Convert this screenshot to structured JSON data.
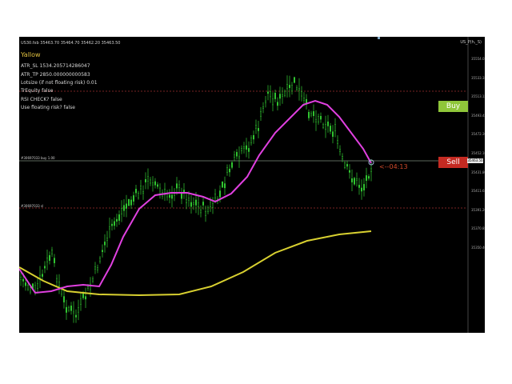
{
  "chart": {
    "symbol_line": "US30.fxb  35463.70 35464.70 35462.20 35463.50",
    "indicator_name": "Yallow",
    "info_lines": [
      "ATR_SL 1534.205714286047",
      "ATR_TP 2850.000000000583",
      "Lotsize (if not floating risk) 0.01",
      "TrEquity false",
      "RSI CHECK? false",
      "Use floating risk? false"
    ],
    "top_right_tag": "US_P(h,_S)",
    "buy_label": "Buy",
    "sell_label": "Sell",
    "countdown": "<--04:13",
    "level_labels": {
      "upper": "#30697033 buy 1.00",
      "lower": "#30697033 sl"
    },
    "current_price_label": "35463.50",
    "price_scale": [
      "35554.05",
      "35533.35",
      "35513.15",
      "35493.45",
      "35472.30",
      "35452.10",
      "35431.80",
      "35411.65",
      "35391.20",
      "35370.85",
      "35350.40"
    ],
    "colors": {
      "background": "#000000",
      "candles": "#33cc33",
      "magenta_ma": "#e040e0",
      "yellow_ma": "#d8d030",
      "level_lines": "#a03030",
      "price_line": "#7a8a7a",
      "buy": "#8fc63a",
      "sell": "#c42a22"
    }
  }
}
